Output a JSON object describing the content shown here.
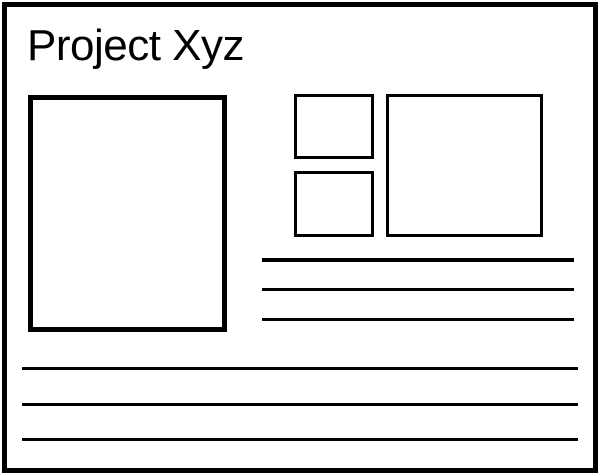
{
  "page": {
    "title": "Project Xyz"
  },
  "colors": {
    "stroke": "#000000",
    "background": "#ffffff"
  },
  "placeholders": {
    "image_boxes": [
      "main-image-placeholder",
      "small-image-placeholder-top",
      "small-image-placeholder-bottom",
      "wide-image-placeholder"
    ],
    "text_lines_side": 3,
    "text_lines_bottom": 3
  }
}
